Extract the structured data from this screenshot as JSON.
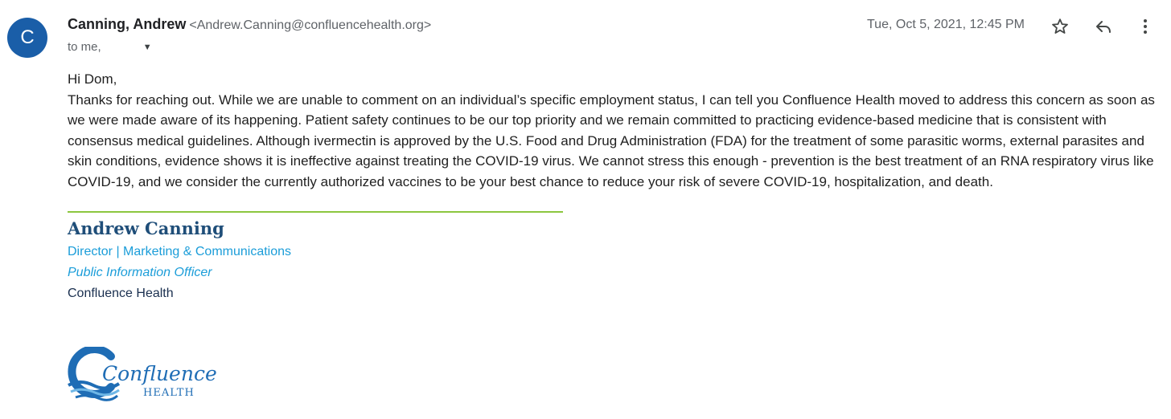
{
  "header": {
    "avatar_letter": "C",
    "sender_name": "Canning, Andrew",
    "sender_email": "<Andrew.Canning@confluencehealth.org>",
    "recipient_label": "to me,",
    "timestamp": "Tue, Oct 5, 2021, 12:45 PM",
    "icons": [
      "star-icon",
      "reply-icon",
      "more-vert-icon",
      "chevron-down-icon"
    ]
  },
  "body": {
    "greeting": "Hi Dom,",
    "paragraph": "Thanks for reaching out. While we are unable to comment on an individual’s specific employment status, I can tell you Confluence Health moved to address this concern as soon as we were made aware of its happening. Patient safety continues to be our top priority and we remain committed to practicing evidence-based medicine that is consistent with consensus medical guidelines. Although ivermectin is approved by the U.S. Food and Drug Administration (FDA) for the treatment of some parasitic worms, external parasites and skin conditions, evidence shows it is ineffective against treating the COVID-19 virus. We cannot stress this enough - prevention is the best treatment of an RNA respiratory virus like COVID-19, and we consider the currently authorized vaccines to be your best chance to reduce your risk of severe COVID-19, hospitalization, and death."
  },
  "signature": {
    "name": "Andrew Canning",
    "title": "Director | Marketing & Communications",
    "role": "Public Information Officer",
    "organization": "Confluence Health",
    "logo_word": "Confluence",
    "logo_sub": "HEALTH"
  },
  "colors": {
    "avatar": "#1a5ea8",
    "divider": "#8cc63f",
    "signature_name": "#1f4e79",
    "signature_accent": "#1b9dd9",
    "logo": "#1f6db5"
  }
}
